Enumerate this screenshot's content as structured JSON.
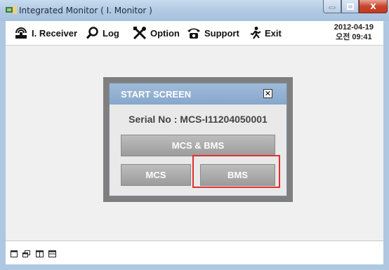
{
  "window": {
    "title": "Integrated Monitor ( I. Monitor )",
    "minimize_icon": "minimize-icon",
    "maximize_icon": "maximize-icon",
    "close_label": "X"
  },
  "toolbar": {
    "items": [
      {
        "label": "I. Receiver",
        "icon": "receiver-icon"
      },
      {
        "label": "Log",
        "icon": "search-icon"
      },
      {
        "label": "Option",
        "icon": "tools-icon"
      },
      {
        "label": "Support",
        "icon": "phone-icon"
      },
      {
        "label": "Exit",
        "icon": "exit-icon"
      }
    ],
    "date": "2012-04-19",
    "time": "오전 09:41"
  },
  "dialog": {
    "title": "START SCREEN",
    "close_label": "✕",
    "serial": "Serial No : MCS-I11204050001",
    "buttons": {
      "both": "MCS & BMS",
      "mcs": "MCS",
      "bms": "BMS"
    }
  },
  "statusbar": {
    "icons": [
      "layout-single-icon",
      "layout-cascade-icon",
      "layout-vertical-icon",
      "layout-horizontal-icon"
    ]
  },
  "colors": {
    "dialog_header": "#9fbbd9",
    "button": "#b0b0b0",
    "highlight": "#e03030"
  }
}
